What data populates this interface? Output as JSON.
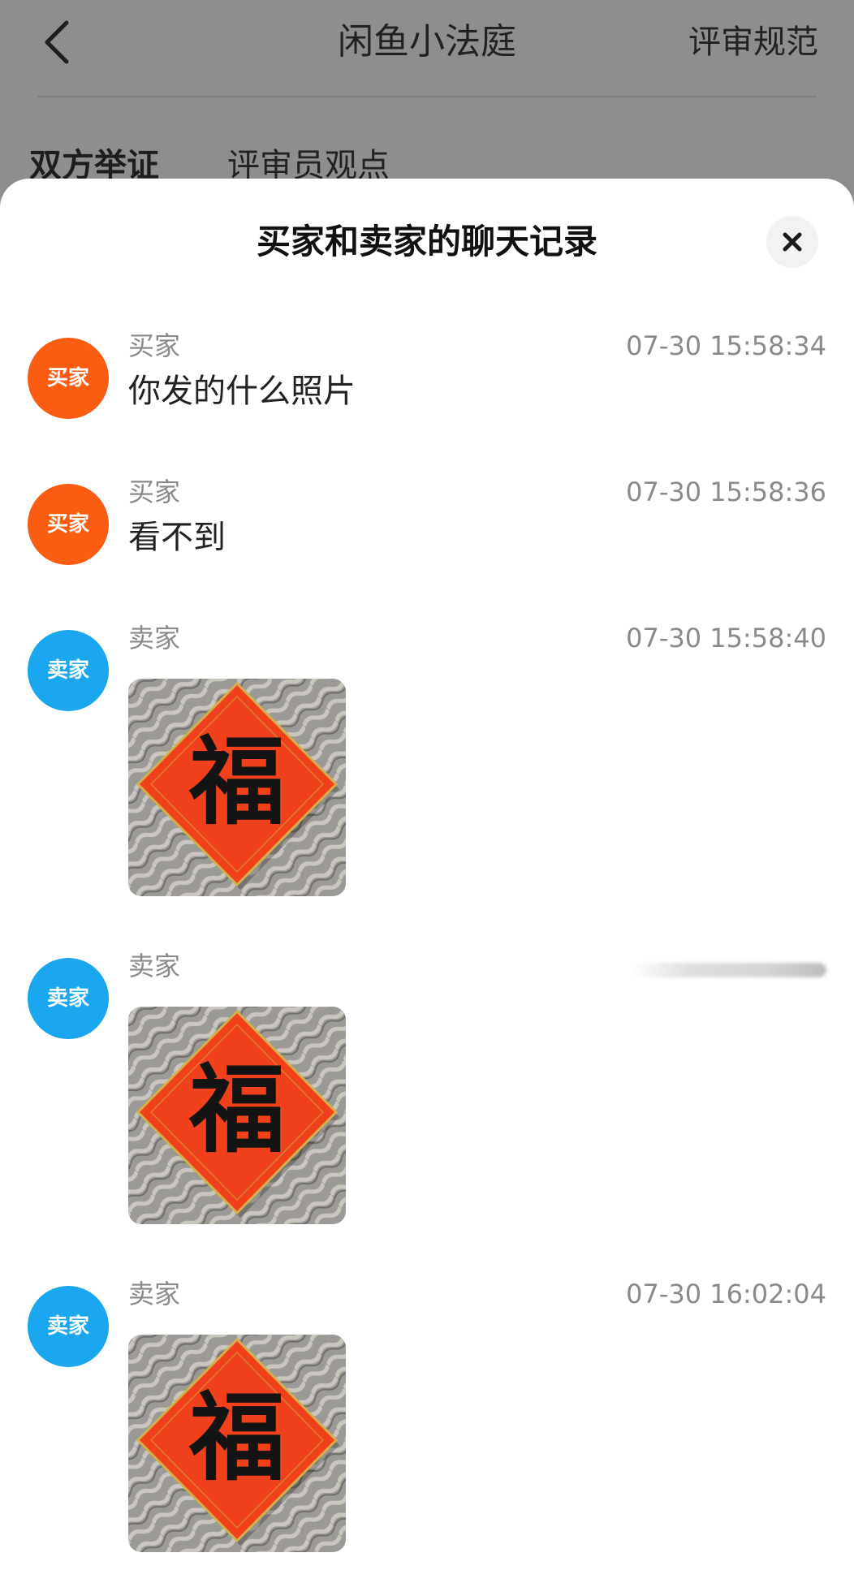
{
  "header": {
    "title": "闲鱼小法庭",
    "right_link": "评审规范",
    "back_icon": "chevron-left-icon"
  },
  "tabs": [
    {
      "label": "双方举证",
      "active": true
    },
    {
      "label": "评审员观点",
      "active": false
    }
  ],
  "sheet": {
    "title": "买家和卖家的聊天记录",
    "close_icon": "close-icon"
  },
  "messages": [
    {
      "sender": "买家",
      "avatar_label": "买家",
      "role": "buyer",
      "time": "07-30 15:58:34",
      "text": "你发的什么照片"
    },
    {
      "sender": "买家",
      "avatar_label": "买家",
      "role": "buyer",
      "time": "07-30 15:58:36",
      "text": "看不到"
    },
    {
      "sender": "卖家",
      "avatar_label": "卖家",
      "role": "seller",
      "time": "07-30 15:58:40",
      "image_char": "福"
    },
    {
      "sender": "卖家",
      "avatar_label": "卖家",
      "role": "seller",
      "time": "",
      "image_char": "福"
    },
    {
      "sender": "卖家",
      "avatar_label": "卖家",
      "role": "seller",
      "time": "07-30 16:02:04",
      "image_char": "福"
    }
  ],
  "colors": {
    "buyer_avatar": "#fa5c12",
    "seller_avatar": "#1aa7f0",
    "overlay": "#8e8e8e",
    "fu_red": "#f0401c"
  }
}
